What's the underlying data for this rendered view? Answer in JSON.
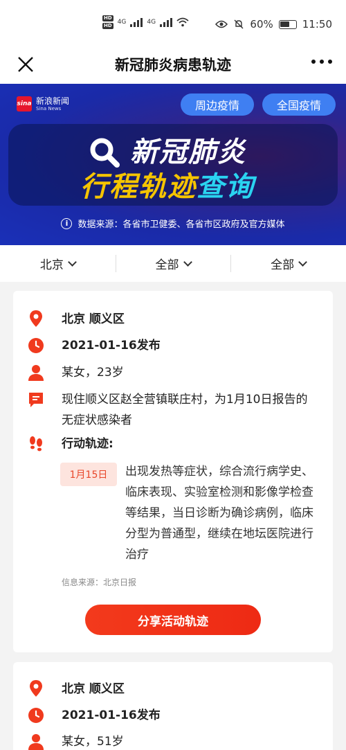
{
  "status_bar": {
    "hd1": "HD",
    "hd2": "HD",
    "net1": "4G",
    "net2": "4G",
    "battery": "60%",
    "time": "11:50"
  },
  "header": {
    "title": "新冠肺炎病患轨迹"
  },
  "banner": {
    "brand_cn": "新浪新闻",
    "brand_en": "Sina News",
    "brand_mark": "sina",
    "nearby_button": "周边疫情",
    "national_button": "全国疫情",
    "hero_line1": "新冠肺炎",
    "hero_line2_part1": "行程轨迹",
    "hero_line2_part2": "查询",
    "source_note": "数据来源：各省市卫健委、各省市区政府及官方媒体"
  },
  "filters": [
    {
      "label": "北京"
    },
    {
      "label": "全部"
    },
    {
      "label": "全部"
    }
  ],
  "cards": [
    {
      "location": "北京 顺义区",
      "published": "2021-01-16发布",
      "person": "某女，23岁",
      "description": "现住顺义区赵全营镇联庄村，为1月10日报告的无症状感染者",
      "trajectory_label": "行动轨迹:",
      "timeline": [
        {
          "date": "1月15日",
          "text": "出现发热等症状，综合流行病学史、临床表现、实验室检测和影像学检查等结果，当日诊断为确诊病例，临床分型为普通型，继续在地坛医院进行治疗"
        }
      ],
      "source": "信息来源：北京日报",
      "share_button": "分享活动轨迹"
    },
    {
      "location": "北京 顺义区",
      "published": "2021-01-16发布",
      "person": "某女，51岁"
    }
  ],
  "colors": {
    "accent": "#f03a1e",
    "pill": "#3f7ff2",
    "banner_blue": "#1a2aa8",
    "tag_bg": "#fde4de"
  },
  "icons": [
    "close-icon",
    "more-icon",
    "search-icon",
    "info-icon",
    "location-pin-icon",
    "clock-icon",
    "person-icon",
    "message-icon",
    "footsteps-icon",
    "chevron-down-icon"
  ]
}
